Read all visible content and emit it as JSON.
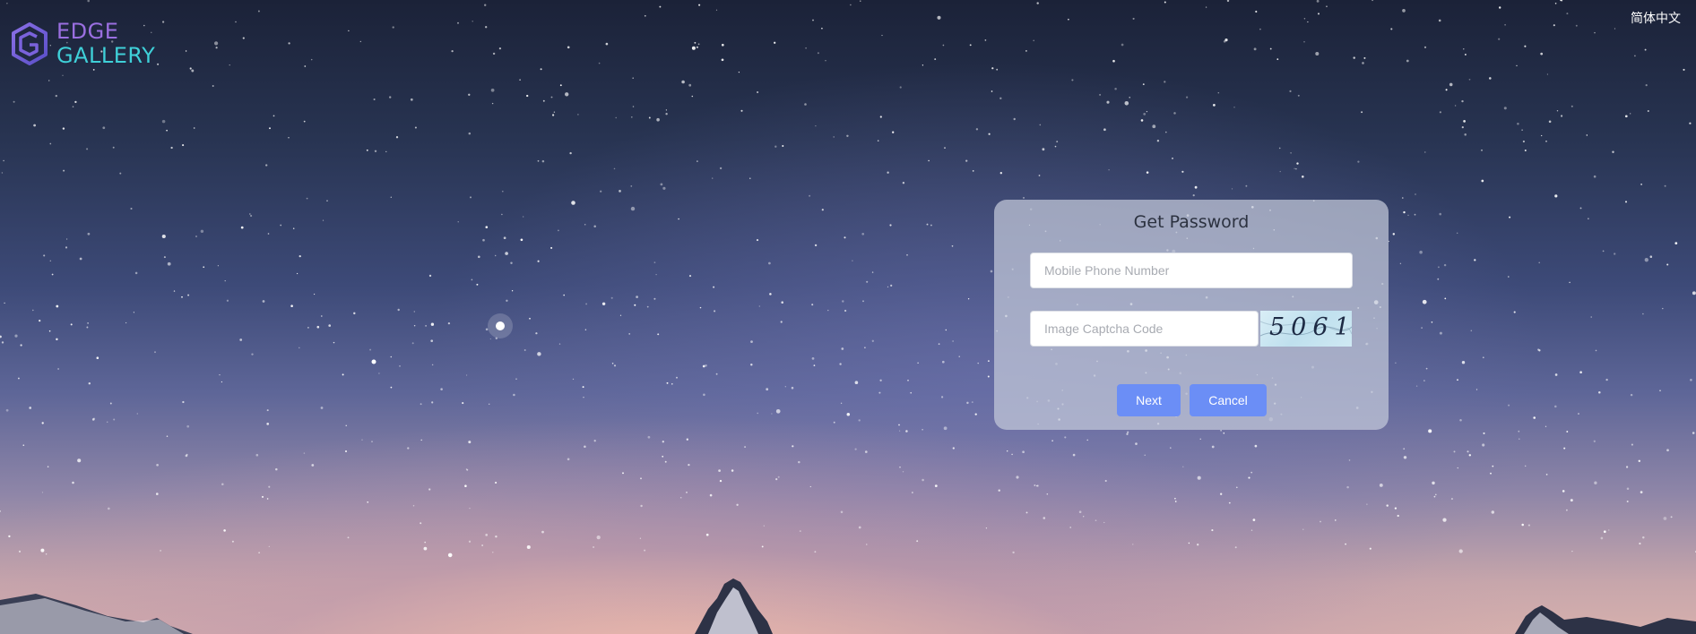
{
  "logo": {
    "line1": "EDGE",
    "line2": "GALLERY",
    "icon": "cube-logo-icon"
  },
  "header": {
    "language_label": "简体中文"
  },
  "card": {
    "title": "Get Password",
    "phone_placeholder": "Mobile Phone Number",
    "phone_value": "",
    "captcha_placeholder": "Image Captcha Code",
    "captcha_value": "",
    "captcha_image_text": "5061",
    "next_label": "Next",
    "cancel_label": "Cancel"
  },
  "colors": {
    "primary_button": "#6b8ef6",
    "logo_purple": "#9a6fe0",
    "logo_cyan": "#3fd0d8"
  }
}
